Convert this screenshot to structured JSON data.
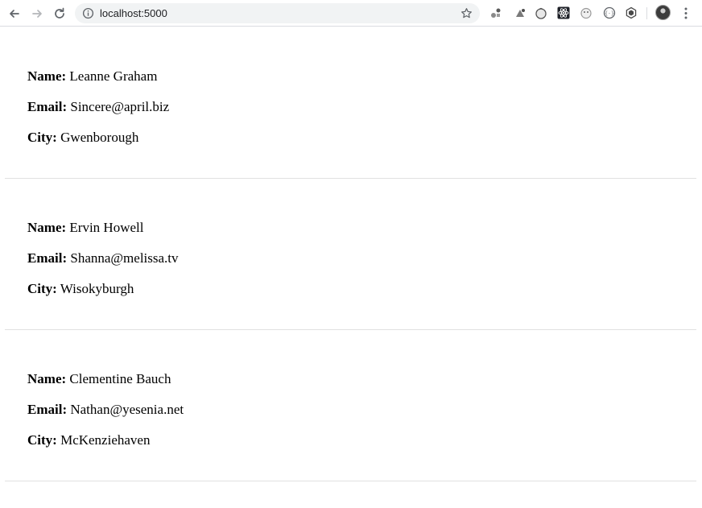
{
  "browser": {
    "url": "localhost:5000",
    "icons": [
      "back-arrow-icon",
      "forward-arrow-icon",
      "reload-icon",
      "info-icon",
      "star-icon",
      "kebab-menu-icon"
    ],
    "extensions": [
      "extension-icon-1",
      "extension-icon-2",
      "extension-icon-3",
      "react-devtools-icon",
      "extension-icon-5",
      "extension-icon-6",
      "extension-icon-7"
    ]
  },
  "labels": {
    "name": "Name:",
    "email": "Email:",
    "city": "City:"
  },
  "users": [
    {
      "name": "Leanne Graham",
      "email": "Sincere@april.biz",
      "city": "Gwenborough"
    },
    {
      "name": "Ervin Howell",
      "email": "Shanna@melissa.tv",
      "city": "Wisokyburgh"
    },
    {
      "name": "Clementine Bauch",
      "email": "Nathan@yesenia.net",
      "city": "McKenziehaven"
    }
  ],
  "colors": {
    "toolbar_bg": "#ffffff",
    "omnibox_bg": "#f1f3f4",
    "divider": "#e1e1e1",
    "text": "#000000"
  }
}
